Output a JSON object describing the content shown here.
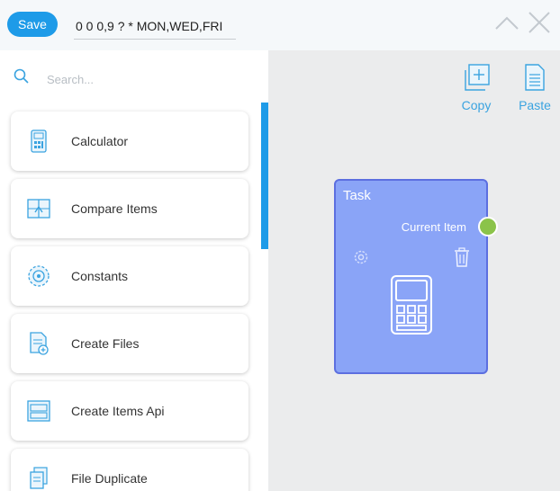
{
  "toolbar": {
    "save_label": "Save",
    "cron_expression": "0 0 0,9 ? * MON,WED,FRI",
    "collapse_icon": "chevron-up-icon",
    "close_icon": "close-icon"
  },
  "sidebar": {
    "search_placeholder": "Search...",
    "items": [
      {
        "label": "Calculator",
        "icon": "calculator-icon"
      },
      {
        "label": "Compare Items",
        "icon": "compare-icon"
      },
      {
        "label": "Constants",
        "icon": "constants-icon"
      },
      {
        "label": "Create Files",
        "icon": "create-files-icon"
      },
      {
        "label": "Create Items Api",
        "icon": "create-items-api-icon"
      },
      {
        "label": "File Duplicate",
        "icon": "file-duplicate-icon"
      }
    ]
  },
  "canvas": {
    "copy_label": "Copy",
    "paste_label": "Paste",
    "node": {
      "title": "Task",
      "output_label": "Current Item",
      "icon": "calculator-icon"
    }
  },
  "colors": {
    "accent": "#1e9be8",
    "node_fill": "#8aa4f7",
    "node_border": "#5c6fe0",
    "output_port": "#8bc34a",
    "canvas_bg": "#ebeced"
  }
}
